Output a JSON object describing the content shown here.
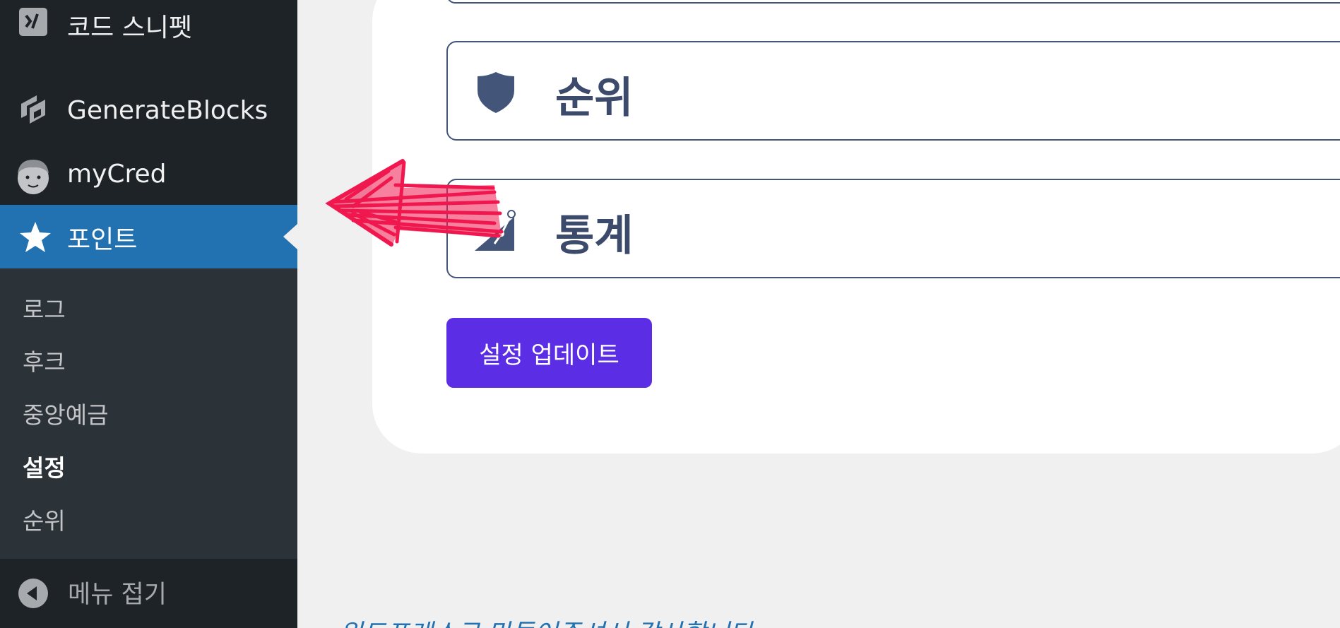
{
  "sidebar": {
    "items": [
      {
        "label": "코드 스니펫",
        "icon": "code-snippets-icon"
      },
      {
        "label": "GenerateBlocks",
        "icon": "generateblocks-icon"
      },
      {
        "label": "myCred",
        "icon": "mycred-face-icon"
      },
      {
        "label": "포인트",
        "icon": "star-icon",
        "active": true
      }
    ],
    "submenu": [
      {
        "label": "로그"
      },
      {
        "label": "후크"
      },
      {
        "label": "중앙예금"
      },
      {
        "label": "설정",
        "current": true
      },
      {
        "label": "순위"
      }
    ],
    "collapse_label": "메뉴 접기"
  },
  "main": {
    "panels": [
      {
        "title": "순위",
        "icon": "shield-icon"
      },
      {
        "title": "통계",
        "icon": "chart-triangle-icon"
      }
    ],
    "save_button": "설정 업데이트",
    "footer_text": "워드프레스로 만들어주셔서 감사합니다."
  },
  "colors": {
    "sidebar_bg": "#1d2327",
    "submenu_bg": "#2c3338",
    "active_bg": "#2271b1",
    "panel_border": "#44557a",
    "panel_text": "#3c4a6b",
    "button_bg": "#5b2ee6",
    "annotation": "#f0184f"
  }
}
